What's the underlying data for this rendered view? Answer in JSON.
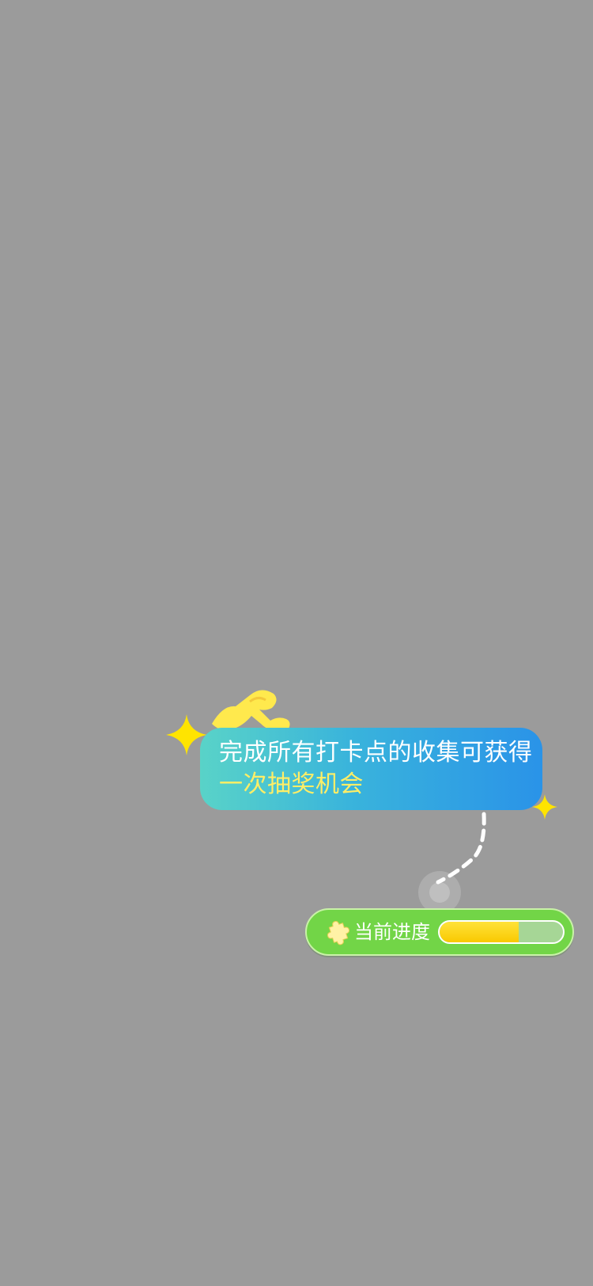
{
  "guide_tip": {
    "line1": "完成所有打卡点的收集可获得",
    "line2": "一次抽奖机会"
  },
  "progress": {
    "label": "当前进度",
    "value": 0.64,
    "icon": "puzzle-icon"
  },
  "colors": {
    "overlay": "#9b9b9b",
    "bubble_start": "#59d3c8",
    "bubble_end": "#2a93e8",
    "highlight_text": "#ffee66",
    "pill": "#72d547",
    "fill": "#f9c900",
    "track": "#a6d696"
  },
  "icons": [
    "sparkle-icon",
    "mascot-icon",
    "touch-indicator-icon",
    "puzzle-icon"
  ]
}
